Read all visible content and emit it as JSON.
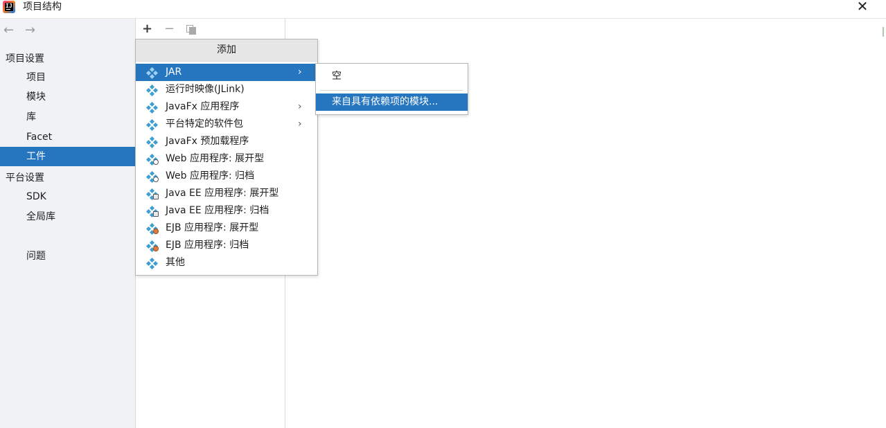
{
  "window": {
    "title": "项目结构",
    "close_glyph": "✕"
  },
  "nav": {
    "back_glyph": "←",
    "forward_glyph": "→"
  },
  "sidebar": {
    "project_settings_label": "项目设置",
    "project_items": [
      {
        "label": "项目"
      },
      {
        "label": "模块"
      },
      {
        "label": "库"
      },
      {
        "label": "Facet"
      },
      {
        "label": "工件",
        "selected": true
      }
    ],
    "platform_settings_label": "平台设置",
    "platform_items": [
      {
        "label": "SDK"
      },
      {
        "label": "全局库"
      }
    ],
    "problems_label": "问题"
  },
  "toolbar": {
    "add_glyph": "+",
    "remove_glyph": "−"
  },
  "add_popup": {
    "header": "添加",
    "items": [
      {
        "label": "JAR",
        "icon": "artifact-icon",
        "has_submenu": true,
        "active": true
      },
      {
        "label": "运行时映像(JLink)",
        "icon": "artifact-icon"
      },
      {
        "label": "JavaFx 应用程序",
        "icon": "artifact-icon",
        "has_submenu": true
      },
      {
        "label": "平台特定的软件包",
        "icon": "artifact-icon",
        "has_submenu": true
      },
      {
        "label": "JavaFx 预加载程序",
        "icon": "artifact-icon"
      },
      {
        "label": "Web 应用程序: 展开型",
        "icon": "web-artifact-icon"
      },
      {
        "label": "Web 应用程序: 归档",
        "icon": "web-artifact-icon"
      },
      {
        "label": "Java EE 应用程序: 展开型",
        "icon": "javaee-artifact-icon"
      },
      {
        "label": "Java EE 应用程序: 归档",
        "icon": "javaee-artifact-icon"
      },
      {
        "label": "EJB 应用程序: 展开型",
        "icon": "ejb-artifact-icon"
      },
      {
        "label": "EJB 应用程序: 归档",
        "icon": "ejb-artifact-icon"
      },
      {
        "label": "其他",
        "icon": "artifact-icon"
      }
    ],
    "submenu_arrow": "›"
  },
  "jar_submenu": {
    "items": [
      {
        "label": "空"
      },
      {
        "label": "来自具有依赖项的模块...",
        "active": true
      }
    ]
  },
  "colors": {
    "selection": "#2675bf",
    "sidebar_bg": "#f0f2f5",
    "artifact_icon": "#3e9fd2"
  }
}
